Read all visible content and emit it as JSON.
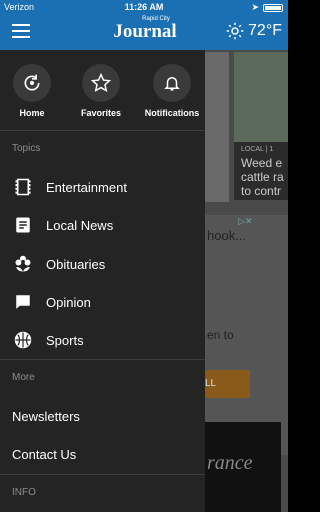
{
  "status_bar": {
    "carrier": "Verizon",
    "time": "11:26 AM"
  },
  "header": {
    "logo_small": "Rapid City",
    "logo_big": "Journal",
    "temperature": "72°F",
    "weather_icon": "sun-icon"
  },
  "drawer": {
    "quick_actions": [
      {
        "label": "Home",
        "icon": "home-refresh-icon"
      },
      {
        "label": "Favorites",
        "icon": "star-icon"
      },
      {
        "label": "Notifications",
        "icon": "bell-icon"
      }
    ],
    "topics_heading": "Topics",
    "topics": [
      {
        "label": "Entertainment",
        "icon": "film-icon"
      },
      {
        "label": "Local News",
        "icon": "document-icon"
      },
      {
        "label": "Obituaries",
        "icon": "flower-icon"
      },
      {
        "label": "Opinion",
        "icon": "speech-bubble-icon"
      },
      {
        "label": "Sports",
        "icon": "ball-icon"
      }
    ],
    "more_heading": "More",
    "more": [
      {
        "label": "Newsletters"
      },
      {
        "label": "Contact Us"
      }
    ],
    "info_heading": "INFO"
  },
  "background": {
    "tag": "LOCAL | 1",
    "headline": "Weed e cattle ra to contr",
    "ad_text": "hook...",
    "ad_text2": "en to",
    "ad_cta": "LL",
    "ad_script": "rance"
  }
}
